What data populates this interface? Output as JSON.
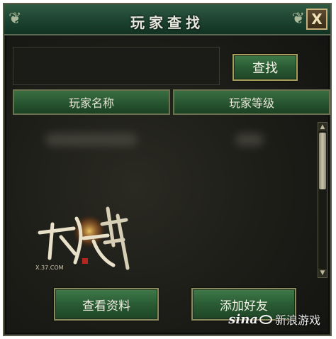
{
  "window": {
    "title": "玩家查找",
    "close_glyph": "X"
  },
  "search": {
    "input_value": "",
    "button_label": "查找"
  },
  "columns": {
    "name": "玩家名称",
    "level": "玩家等级"
  },
  "actions": {
    "view_profile": "查看资料",
    "add_friend": "添加好友"
  },
  "logo": {
    "brand_text": "X.37.COM"
  },
  "watermark": {
    "brand": "sina",
    "label": "新浪游戏"
  },
  "colors": {
    "accent_green": "#2a5b33",
    "panel_bg": "#1a1a16",
    "title_green": "#1d4330"
  }
}
